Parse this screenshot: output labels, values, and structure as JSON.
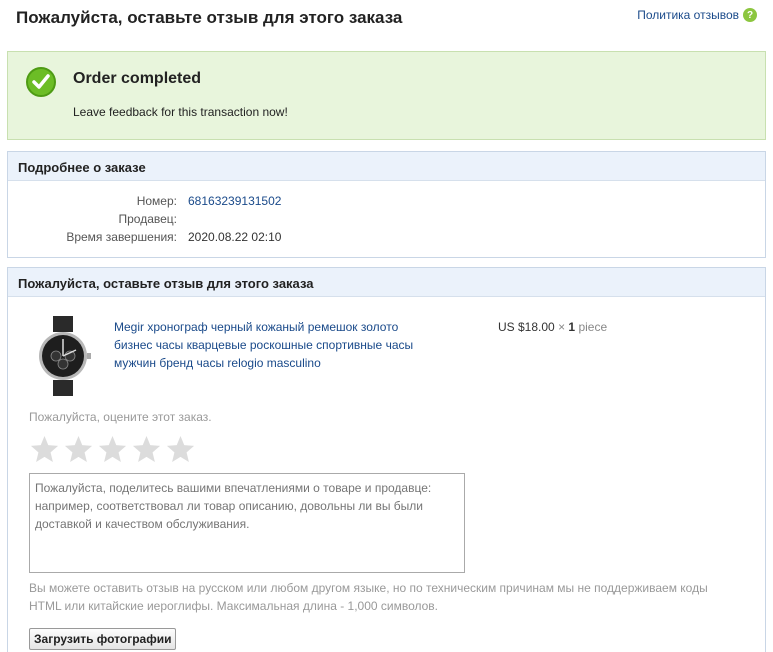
{
  "header": {
    "title": "Пожалуйста, оставьте отзыв для этого заказа",
    "policy_link": "Политика отзывов",
    "help_icon_glyph": "?"
  },
  "status": {
    "title": "Order completed",
    "message": "Leave feedback for this transaction now!",
    "icon": "check-circle-icon",
    "color": "#6cbd26"
  },
  "details": {
    "heading": "Подробнее о заказе",
    "rows": [
      {
        "label": "Номер:",
        "value": "68163239131502"
      },
      {
        "label": "Продавец:",
        "value": ""
      },
      {
        "label": "Время завершения:",
        "value": "2020.08.22 02:10"
      }
    ]
  },
  "feedback": {
    "heading": "Пожалуйста, оставьте отзыв для этого заказа",
    "product": {
      "title": "Megir хронограф черный кожаный ремешок золото бизнес часы кварцевые роскошные спортивные часы мужчин бренд часы relogio masculino",
      "price": "US $18.00",
      "qty_sep": "×",
      "qty": "1",
      "unit": "piece"
    },
    "rating_label": "Пожалуйста, оцените этот заказ.",
    "rating_value": 0,
    "rating_max": 5,
    "comment_placeholder": "Пожалуйста, поделитесь вашими впечатлениями о товаре и продавце: например, соответствовал ли товар описанию, довольны ли вы были доставкой и качеством обслуживания.",
    "hint": "Вы можете оставить отзыв на русском или любом другом языке, но по техническим причинам мы не поддерживаем коды HTML или китайские иероглифы. Максимальная длина - 1,000 символов.",
    "upload_label": "Загрузить фотографии"
  }
}
